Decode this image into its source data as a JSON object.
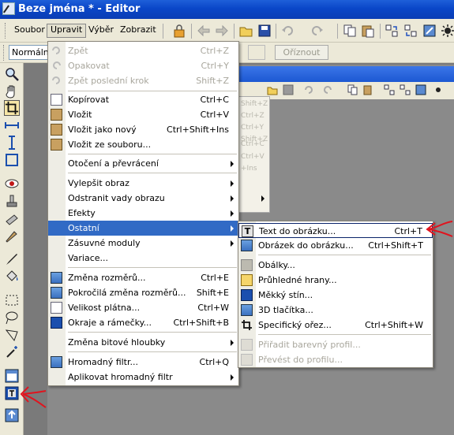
{
  "window": {
    "title": "Beze jména * - Editor"
  },
  "menubar": {
    "items": [
      {
        "label": "Soubor"
      },
      {
        "label": "Upravit"
      },
      {
        "label": "Výběr"
      },
      {
        "label": "Zobrazit"
      }
    ]
  },
  "options_bar": {
    "mode_value": "Normální",
    "crop_button": "Oříznout"
  },
  "edit_menu": {
    "items": [
      {
        "label": "Zpět",
        "shortcut": "Ctrl+Z"
      },
      {
        "label": "Opakovat",
        "shortcut": "Ctrl+Y"
      },
      {
        "label": "Zpět poslední krok",
        "shortcut": "Shift+Z"
      },
      {
        "label": "Kopírovat",
        "shortcut": "Ctrl+C"
      },
      {
        "label": "Vložit",
        "shortcut": "Ctrl+V"
      },
      {
        "label": "Vložit jako nový",
        "shortcut": "Ctrl+Shift+Ins"
      },
      {
        "label": "Vložit ze souboru..."
      },
      {
        "label": "Otočení a převrácení"
      },
      {
        "label": "Vylepšit obraz"
      },
      {
        "label": "Odstranit vady obrazu"
      },
      {
        "label": "Efekty"
      },
      {
        "label": "Ostatní"
      },
      {
        "label": "Zásuvné moduly"
      },
      {
        "label": "Variace..."
      },
      {
        "label": "Změna rozměrů...",
        "shortcut": "Ctrl+E"
      },
      {
        "label": "Pokročilá změna rozměrů...",
        "shortcut": "Shift+E"
      },
      {
        "label": "Velikost plátna...",
        "shortcut": "Ctrl+W"
      },
      {
        "label": "Okraje a rámečky...",
        "shortcut": "Ctrl+Shift+B"
      },
      {
        "label": "Změna bitové hloubky"
      },
      {
        "label": "Hromadný filtr...",
        "shortcut": "Ctrl+Q"
      },
      {
        "label": "Aplikovat hromadný filtr"
      }
    ]
  },
  "other_submenu": {
    "items": [
      {
        "label": "Text do obrázku...",
        "shortcut": "Ctrl+T"
      },
      {
        "label": "Obrázek do obrázku...",
        "shortcut": "Ctrl+Shift+T"
      },
      {
        "label": "Obálky..."
      },
      {
        "label": "Průhledné hrany..."
      },
      {
        "label": "Měkký stín..."
      },
      {
        "label": "3D tlačítka..."
      },
      {
        "label": "Specifický ořez...",
        "shortcut": "Ctrl+Shift+W"
      },
      {
        "label": "Přiřadit barevný profil..."
      },
      {
        "label": "Převést do profilu..."
      }
    ]
  },
  "ghost_menu": {
    "items": [
      "Shift+Z",
      "Ctrl+Z",
      "Ctrl+Y",
      "Shift+Z",
      "Ctrl+C",
      "Ctrl+V",
      "+Ins"
    ]
  },
  "colors": {
    "highlight": "#316ac5",
    "annotation_arrow": "#e0141e"
  }
}
